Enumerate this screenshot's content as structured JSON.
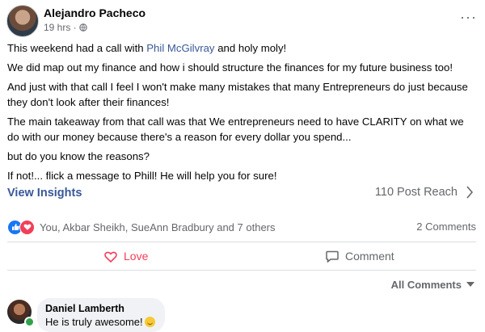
{
  "post": {
    "author": "Alejandro Pacheco",
    "time": "19 hrs ·",
    "privacy_icon": "globe-icon",
    "more_icon": "···",
    "paragraphs": {
      "p1_before": "This weekend had a call with ",
      "p1_mention": "Phil McGilvray",
      "p1_after": " and holy moly!",
      "p2": "We did map out my finance and how i should structure the finances for my future business too!",
      "p3": "And just with that call I feel I won't make many mistakes that many Entrepreneurs do just because they don't look after their finances!",
      "p4": "The main takeaway from that call was that We entrepreneurs need to have CLARITY on what we do with our money because there's a reason for every dollar you spend...",
      "p5": "but do you know the reasons?",
      "p6": "If not!... flick a message to Phill! He will help you for sure!"
    }
  },
  "insights": {
    "link": "View Insights",
    "reach": "110 Post Reach"
  },
  "reactions": {
    "icons": [
      "like-icon",
      "love-icon"
    ],
    "names": "You, Akbar Sheikh, SueAnn Bradbury and 7 others",
    "comments": "2 Comments"
  },
  "actions": {
    "love": "Love",
    "comment": "Comment"
  },
  "filter": {
    "label": "All Comments"
  },
  "comment": {
    "name": "Daniel Lamberth",
    "text": "He is truly awesome!",
    "emoji_icon": "smile-emoji-icon"
  },
  "colors": {
    "link_blue": "#385898",
    "love_red": "#f33e58",
    "like_blue": "#1877f2",
    "muted": "#65676b"
  }
}
